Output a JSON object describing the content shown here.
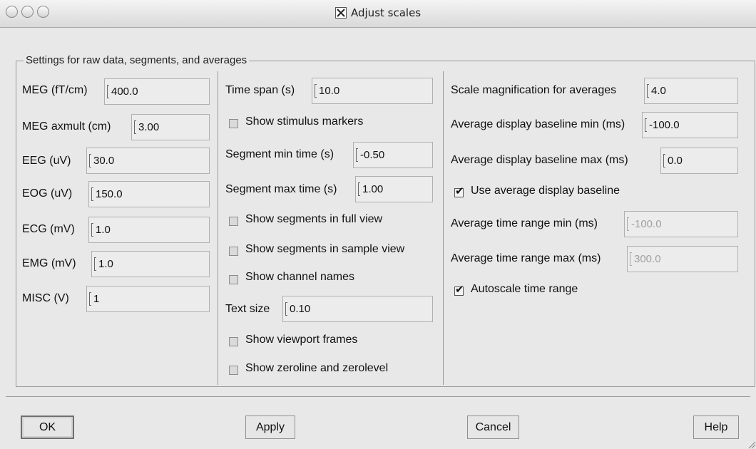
{
  "window": {
    "title": "Adjust scales",
    "title_icon": "x11-icon"
  },
  "group": {
    "legend": "Settings for raw data, segments, and averages"
  },
  "col1": {
    "meg": {
      "label": "MEG (fT/cm)",
      "value": "400.0"
    },
    "meg_axmult": {
      "label": "MEG axmult (cm)",
      "value": "3.00"
    },
    "eeg": {
      "label": "EEG (uV)",
      "value": "30.0"
    },
    "eog": {
      "label": "EOG (uV)",
      "value": "150.0"
    },
    "ecg": {
      "label": "ECG (mV)",
      "value": "1.0"
    },
    "emg": {
      "label": "EMG (mV)",
      "value": "1.0"
    },
    "misc": {
      "label": "MISC (V)",
      "value": "1"
    }
  },
  "col2": {
    "time_span": {
      "label": "Time span (s)",
      "value": "10.0"
    },
    "show_stimulus_markers": {
      "label": "Show stimulus markers",
      "checked": false
    },
    "segment_min": {
      "label": "Segment min time (s)",
      "value": "-0.50"
    },
    "segment_max": {
      "label": "Segment max time (s)",
      "value": "1.00"
    },
    "show_segments_full": {
      "label": "Show segments in full view",
      "checked": false
    },
    "show_segments_sample": {
      "label": "Show segments in sample view",
      "checked": false
    },
    "show_channel_names": {
      "label": "Show channel names",
      "checked": false
    },
    "text_size": {
      "label": "Text size",
      "value": "0.10"
    },
    "show_viewport_frames": {
      "label": "Show viewport frames",
      "checked": false
    },
    "show_zeroline": {
      "label": "Show zeroline and zerolevel",
      "checked": false
    }
  },
  "col3": {
    "scale_magnification": {
      "label": "Scale magnification for averages",
      "value": "4.0"
    },
    "baseline_min": {
      "label": "Average display baseline min (ms)",
      "value": "-100.0"
    },
    "baseline_max": {
      "label": "Average display baseline max (ms)",
      "value": "0.0"
    },
    "use_baseline": {
      "label": "Use average display baseline",
      "checked": true
    },
    "time_range_min": {
      "label": "Average time range min (ms)",
      "value": "-100.0",
      "disabled": true
    },
    "time_range_max": {
      "label": "Average time range max (ms)",
      "value": "300.0",
      "disabled": true
    },
    "autoscale": {
      "label": "Autoscale time range",
      "checked": true
    }
  },
  "buttons": {
    "ok": "OK",
    "apply": "Apply",
    "cancel": "Cancel",
    "help": "Help"
  },
  "check_glyph": "✔"
}
